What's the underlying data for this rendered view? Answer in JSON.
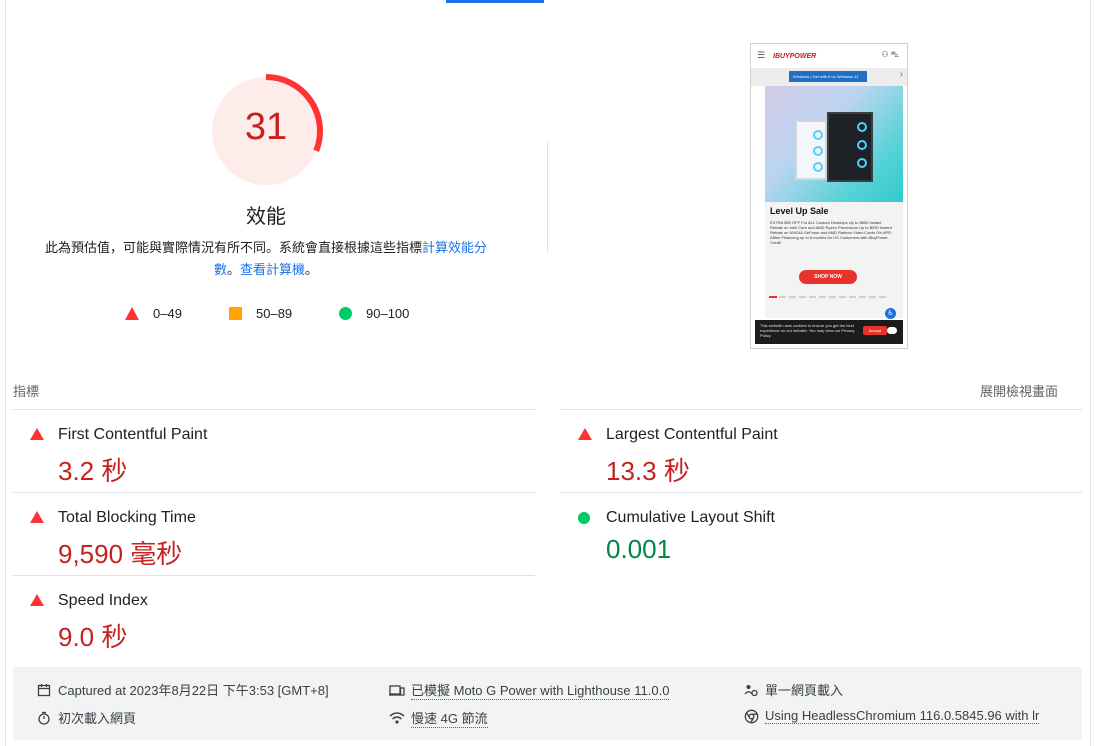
{
  "gauge": {
    "score": "31",
    "score_fraction": 0.31,
    "title": "效能",
    "color": "#ff3333"
  },
  "description": {
    "text": "此為預估值，可能與實際情況有所不同。系統會直接根據這些指標",
    "link1": "計算效能分數",
    "sep": "。",
    "link2": "查看計算機",
    "end": "。"
  },
  "legend": [
    {
      "icon": "red-triangle-icon",
      "label": "0–49"
    },
    {
      "icon": "orange-square-icon",
      "label": "50–89"
    },
    {
      "icon": "green-circle-icon",
      "label": "90–100"
    }
  ],
  "screenshot": {
    "logo": "IBUYPOWER",
    "windows_banner": "Windows  |  Get with it on Windows 11",
    "promo_title": "Level Up Sale",
    "promo_text": "EXTRA $50 OFF For ALL Custom Desktops Up to $800 Instant Rebate on Intel Core and AMD Ryzen Processors Up to $290 Instant Rebate on NVIDIA GeForce and AMD Radeon Video Cards 0% APR Affirm Financing up to 6 months for US Customers with iBuyPower Credit",
    "shop_button": "SHOP NOW",
    "cookie_text": "This website uses cookies to ensure you get the best experience on our website. You may view our Privacy Policy.",
    "cookie_button": "Accept"
  },
  "metrics": {
    "section_label": "指標",
    "expand_label": "展開檢視畫面",
    "items": [
      {
        "name": "First Contentful Paint",
        "value": "3.2 秒",
        "status": "fail"
      },
      {
        "name": "Largest Contentful Paint",
        "value": "13.3 秒",
        "status": "fail"
      },
      {
        "name": "Total Blocking Time",
        "value": "9,590 毫秒",
        "status": "fail"
      },
      {
        "name": "Cumulative Layout Shift",
        "value": "0.001",
        "status": "pass"
      },
      {
        "name": "Speed Index",
        "value": "9.0 秒",
        "status": "fail"
      }
    ]
  },
  "footer": {
    "captured": "Captured at 2023年8月22日 下午3:53 [GMT+8]",
    "device": "已模擬 Moto G Power with Lighthouse 11.0.0",
    "session": "單一網頁載入",
    "load": "初次載入網頁",
    "throttling": "慢速 4G 節流",
    "browser": "Using HeadlessChromium 116.0.5845.96 with lr"
  },
  "colors": {
    "fail": "#c5221f",
    "pass": "#018642",
    "link": "#1a73e8",
    "footer_bg": "#f1f3f4"
  }
}
